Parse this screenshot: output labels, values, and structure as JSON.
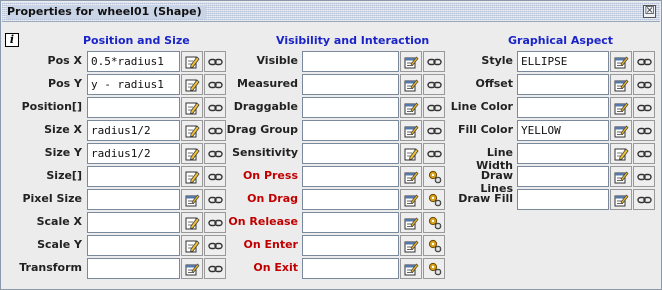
{
  "window": {
    "title": "Properties for wheel01 (Shape)",
    "close_glyph": "☒"
  },
  "header": {
    "info_glyph": "i",
    "sections": [
      "Position and Size",
      "Visibility and Interaction",
      "Graphical Aspect"
    ]
  },
  "colors": {
    "section_title": "#1a24c8",
    "event_label": "#c00000"
  },
  "position_and_size": [
    {
      "label": "Pos X",
      "value": "0.5*radius1",
      "edit_icon": "edit-pencil-icon",
      "link_icon": "link-chain-icon"
    },
    {
      "label": "Pos Y",
      "value": "y - radius1",
      "edit_icon": "edit-pencil-icon",
      "link_icon": "link-chain-icon"
    },
    {
      "label": "Position[]",
      "value": "",
      "edit_icon": "edit-pencil-icon",
      "link_icon": "link-chain-icon"
    },
    {
      "label": "Size X",
      "value": "radius1/2",
      "edit_icon": "edit-pencil-icon",
      "link_icon": "link-chain-icon"
    },
    {
      "label": "Size Y",
      "value": "radius1/2",
      "edit_icon": "edit-pencil-icon",
      "link_icon": "link-chain-icon"
    },
    {
      "label": "Size[]",
      "value": "",
      "edit_icon": "edit-pencil-icon",
      "link_icon": "link-chain-icon"
    },
    {
      "label": "Pixel Size",
      "value": "",
      "edit_icon": "edit-form-icon",
      "link_icon": "link-chain-icon"
    },
    {
      "label": "Scale X",
      "value": "",
      "edit_icon": "edit-pencil-icon",
      "link_icon": "link-chain-icon"
    },
    {
      "label": "Scale Y",
      "value": "",
      "edit_icon": "edit-pencil-icon",
      "link_icon": "link-chain-icon"
    },
    {
      "label": "Transform",
      "value": "",
      "edit_icon": "edit-form-icon",
      "link_icon": "link-chain-icon"
    }
  ],
  "visibility_and_interaction": [
    {
      "label": "Visible",
      "value": "",
      "event": false,
      "edit_icon": "edit-form-icon",
      "link_icon": "link-chain-icon"
    },
    {
      "label": "Measured",
      "value": "",
      "event": false,
      "edit_icon": "edit-form-icon",
      "link_icon": "link-chain-icon"
    },
    {
      "label": "Draggable",
      "value": "",
      "event": false,
      "edit_icon": "edit-form-icon",
      "link_icon": "link-chain-icon"
    },
    {
      "label": "Drag Group",
      "value": "",
      "event": false,
      "edit_icon": "edit-form-icon",
      "link_icon": "link-chain-icon"
    },
    {
      "label": "Sensitivity",
      "value": "",
      "event": false,
      "edit_icon": "edit-pencil-icon",
      "link_icon": "link-chain-icon"
    },
    {
      "label": "On Press",
      "value": "",
      "event": true,
      "edit_icon": "edit-form-icon",
      "link_icon": "action-gears-icon"
    },
    {
      "label": "On Drag",
      "value": "",
      "event": true,
      "edit_icon": "edit-form-icon",
      "link_icon": "action-gears-icon"
    },
    {
      "label": "On Release",
      "value": "",
      "event": true,
      "edit_icon": "edit-form-icon",
      "link_icon": "action-gears-icon"
    },
    {
      "label": "On Enter",
      "value": "",
      "event": true,
      "edit_icon": "edit-form-icon",
      "link_icon": "action-gears-icon"
    },
    {
      "label": "On Exit",
      "value": "",
      "event": true,
      "edit_icon": "edit-form-icon",
      "link_icon": "action-gears-icon"
    }
  ],
  "graphical_aspect": [
    {
      "label": "Style",
      "value": "ELLIPSE",
      "edit_icon": "edit-form-icon",
      "link_icon": "link-chain-icon"
    },
    {
      "label": "Offset",
      "value": "",
      "edit_icon": "edit-form-icon",
      "link_icon": "link-chain-icon"
    },
    {
      "label": "Line Color",
      "value": "",
      "edit_icon": "edit-form-icon",
      "link_icon": "link-chain-icon"
    },
    {
      "label": "Fill Color",
      "value": "YELLOW",
      "edit_icon": "edit-form-icon",
      "link_icon": "link-chain-icon"
    },
    {
      "label": "Line Width",
      "value": "",
      "edit_icon": "edit-pencil-icon",
      "link_icon": "link-chain-icon"
    },
    {
      "label": "Draw Lines",
      "value": "",
      "edit_icon": "edit-form-icon",
      "link_icon": "link-chain-icon"
    },
    {
      "label": "Draw Fill",
      "value": "",
      "edit_icon": "edit-form-icon",
      "link_icon": "link-chain-icon"
    }
  ]
}
